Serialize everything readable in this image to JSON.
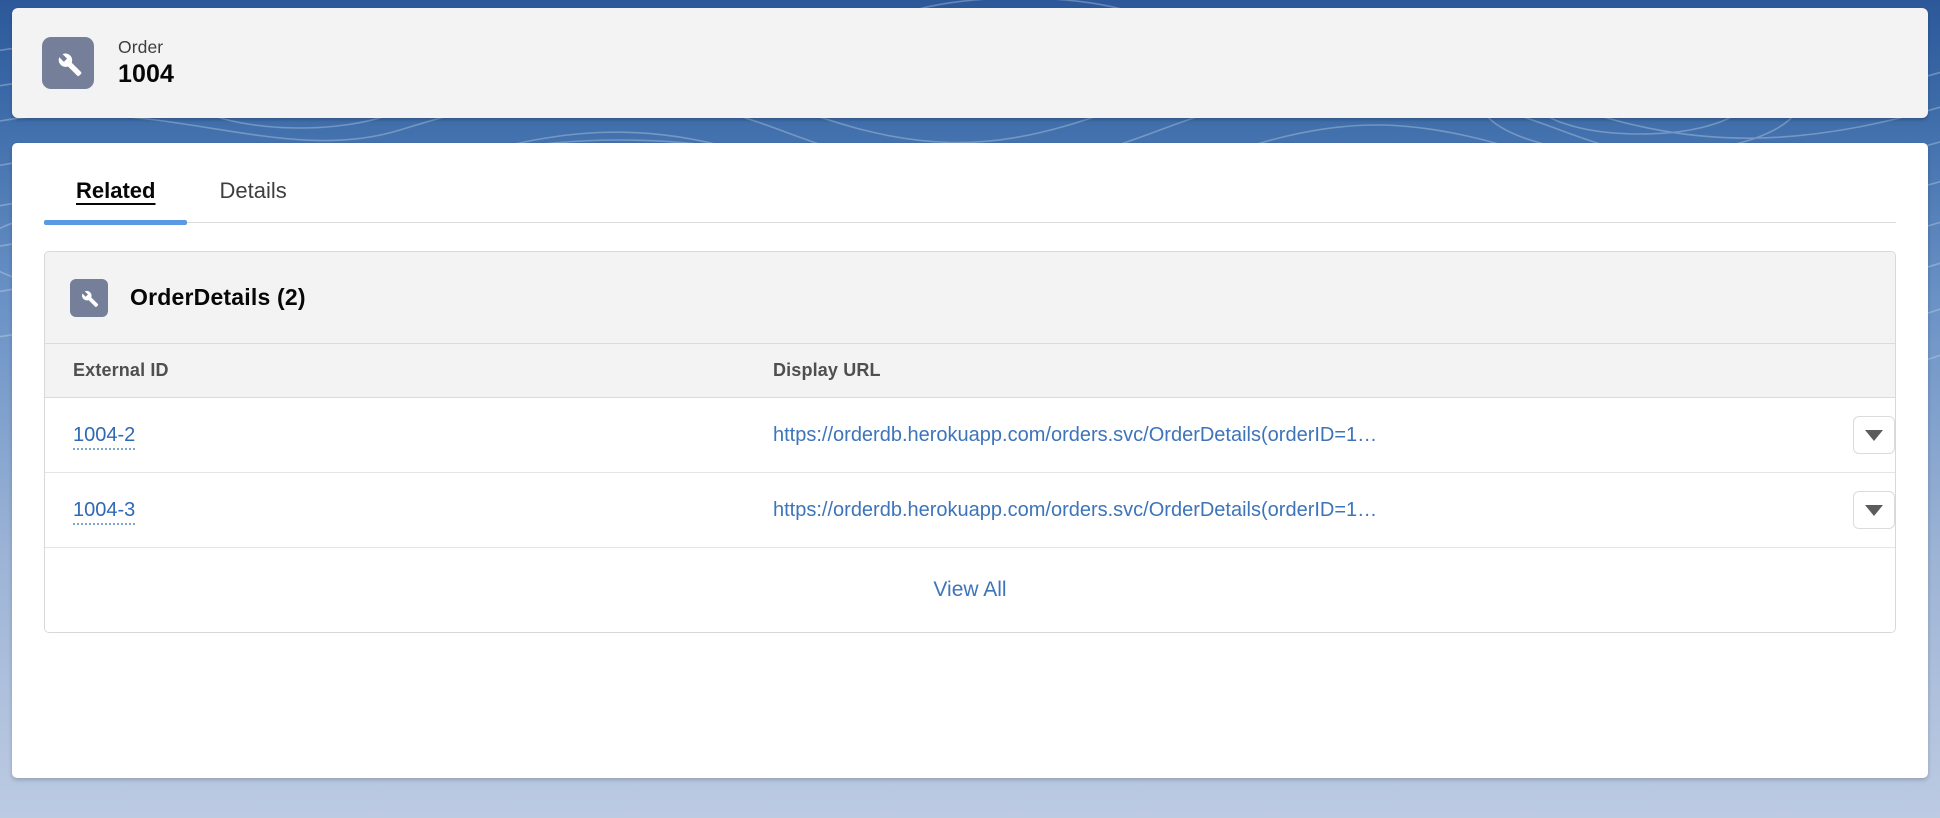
{
  "highlights": {
    "object_label": "Order",
    "record_title": "1004",
    "icon": "wrench-icon"
  },
  "tabs": [
    {
      "label": "Related",
      "active": true
    },
    {
      "label": "Details",
      "active": false
    }
  ],
  "related_list": {
    "icon": "wrench-icon",
    "title": "OrderDetails (2)",
    "columns": [
      {
        "label": "External ID"
      },
      {
        "label": "Display URL"
      }
    ],
    "rows": [
      {
        "external_id": "1004-2",
        "display_url": "https://orderdb.herokuapp.com/orders.svc/OrderDetails(orderID=1…",
        "row_menu_icon": "chevron-down-icon"
      },
      {
        "external_id": "1004-3",
        "display_url": "https://orderdb.herokuapp.com/orders.svc/OrderDetails(orderID=1…",
        "row_menu_icon": "chevron-down-icon"
      }
    ],
    "footer_label": "View All"
  },
  "colors": {
    "link": "#3d74ba",
    "active_tab_indicator": "#5a9ae2",
    "icon_background": "#757f99",
    "background_blue": "#2c5899"
  }
}
